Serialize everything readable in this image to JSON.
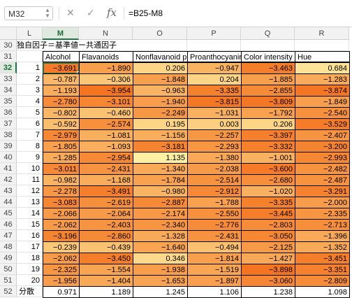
{
  "formula_bar": {
    "name_box": "M32",
    "formula": "=B25-M8",
    "fx_label": "fx"
  },
  "columns": [
    "L",
    "M",
    "N",
    "O",
    "P",
    "Q",
    "R"
  ],
  "selected_column": "M",
  "selected_row": "32",
  "title_row": {
    "row": "30",
    "text": "独自因子＝基準値ー共通因子"
  },
  "header_row": {
    "row": "31",
    "headers": [
      "Alcohol",
      "Flavanoids",
      "Nonflavanoid p",
      "Proanthocyanin",
      "Color intensity",
      "Hue"
    ]
  },
  "data_rows": [
    {
      "row": "32",
      "idx": "1",
      "values": [
        "−3.691",
        "−1.890",
        "0.206",
        "−0.947",
        "−3.463",
        "0.684"
      ]
    },
    {
      "row": "33",
      "idx": "2",
      "values": [
        "−0.787",
        "−0.306",
        "−1.848",
        "0.204",
        "−1.885",
        "−1.283"
      ]
    },
    {
      "row": "34",
      "idx": "3",
      "values": [
        "−1.193",
        "−3.954",
        "−0.963",
        "−3.335",
        "−2.855",
        "−3.874"
      ]
    },
    {
      "row": "35",
      "idx": "4",
      "values": [
        "−2.780",
        "−3.101",
        "−1.940",
        "−3.815",
        "−3.809",
        "−1.849"
      ]
    },
    {
      "row": "36",
      "idx": "5",
      "values": [
        "−0.802",
        "−0.460",
        "−2.249",
        "−1.031",
        "−1.792",
        "−2.540"
      ]
    },
    {
      "row": "37",
      "idx": "6",
      "values": [
        "−0.592",
        "−2.574",
        "0.195",
        "0.003",
        "0.206",
        "−3.529"
      ]
    },
    {
      "row": "38",
      "idx": "7",
      "values": [
        "−2.979",
        "−1.081",
        "−1.156",
        "−2.257",
        "−3.397",
        "−2.407"
      ]
    },
    {
      "row": "39",
      "idx": "8",
      "values": [
        "−1.805",
        "−1.093",
        "−3.181",
        "−2.293",
        "−3.332",
        "−3.200"
      ]
    },
    {
      "row": "40",
      "idx": "9",
      "values": [
        "−1.285",
        "−2.954",
        "1.135",
        "−1.380",
        "−1.001",
        "−2.993"
      ]
    },
    {
      "row": "41",
      "idx": "10",
      "values": [
        "−3.011",
        "−2.431",
        "−1.340",
        "−2.038",
        "−3.600",
        "−2.482"
      ]
    },
    {
      "row": "42",
      "idx": "11",
      "values": [
        "−0.982",
        "−1.168",
        "−1.784",
        "−2.514",
        "−2.680",
        "−2.487"
      ]
    },
    {
      "row": "43",
      "idx": "12",
      "values": [
        "−2.278",
        "−3.491",
        "−0.980",
        "−2.912",
        "−1.020",
        "−3.291"
      ]
    },
    {
      "row": "44",
      "idx": "13",
      "values": [
        "−3.083",
        "−2.619",
        "−2.887",
        "−1.788",
        "−3.335",
        "−2.000"
      ]
    },
    {
      "row": "45",
      "idx": "14",
      "values": [
        "−2.066",
        "−2.064",
        "−2.174",
        "−2.550",
        "−3.445",
        "−2.335"
      ]
    },
    {
      "row": "46",
      "idx": "15",
      "values": [
        "−2.062",
        "−2.403",
        "−2.340",
        "−2.776",
        "−2.803",
        "−2.713"
      ]
    },
    {
      "row": "47",
      "idx": "16",
      "values": [
        "−3.196",
        "−2.860",
        "−1.328",
        "−2.431",
        "−3.050",
        "−1.396"
      ]
    },
    {
      "row": "48",
      "idx": "17",
      "values": [
        "−0.239",
        "−0.439",
        "−1.640",
        "−0.494",
        "−2.125",
        "−1.352"
      ]
    },
    {
      "row": "49",
      "idx": "18",
      "values": [
        "−2.062",
        "−3.450",
        "0.346",
        "−1.814",
        "−1.427",
        "−3.451"
      ]
    },
    {
      "row": "50",
      "idx": "19",
      "values": [
        "−2.325",
        "−1.554",
        "−1.938",
        "−1.519",
        "−3.898",
        "−3.351"
      ]
    },
    {
      "row": "51",
      "idx": "20",
      "values": [
        "−1.956",
        "−1.404",
        "−1.653",
        "−1.897",
        "−3.060",
        "−2.809"
      ]
    }
  ],
  "variance_row": {
    "row": "52",
    "label": "分散",
    "values": [
      "0.971",
      "1.189",
      "1.245",
      "1.106",
      "1.238",
      "1.098"
    ]
  },
  "colors": {
    "accent": "#217346",
    "heat_low": "#f4731f",
    "heat_mid": "#f9ae5c",
    "heat_high": "#fff2a6"
  }
}
